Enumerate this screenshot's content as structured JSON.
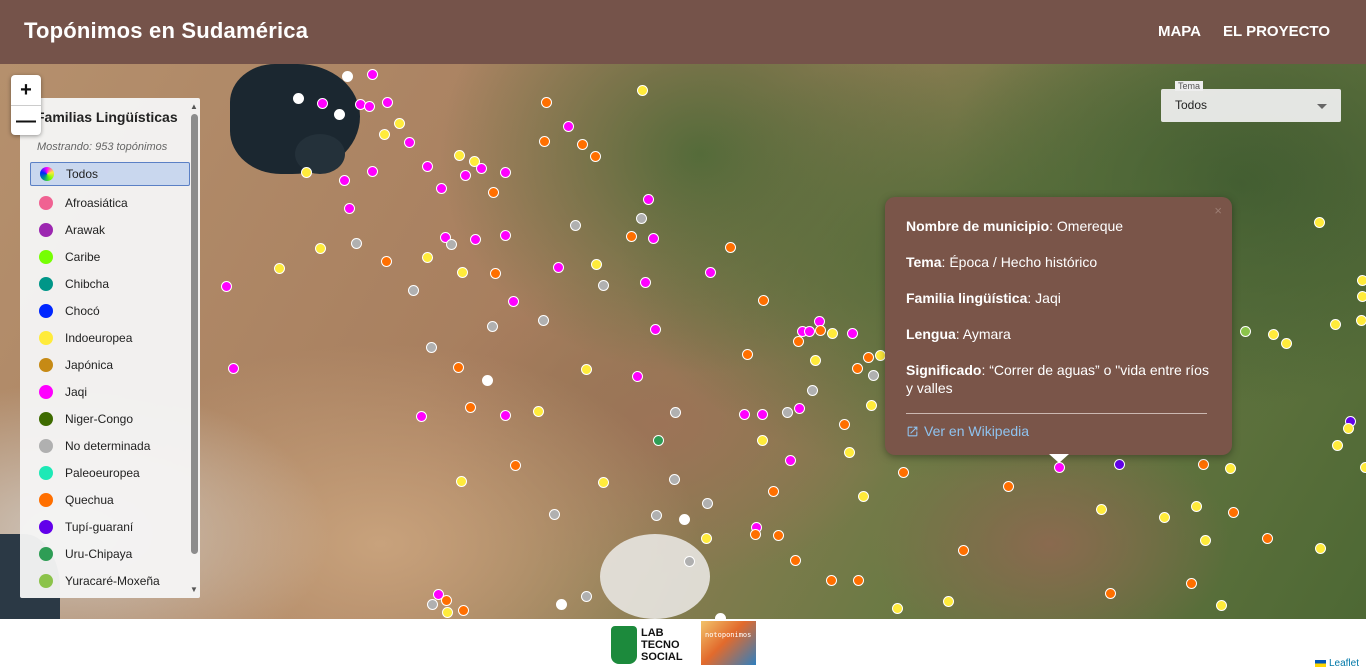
{
  "header": {
    "title": "Topónimos en Sudamérica",
    "nav": [
      "MAPA",
      "EL PROYECTO"
    ]
  },
  "map": {
    "zoom_in": "+",
    "zoom_out": "—",
    "attribution": "Leaflet",
    "colors": {
      "Afroasiática": "#f06292",
      "Arawak": "#9c27b0",
      "Caribe": "#76ff03",
      "Chibcha": "#009688",
      "Chocó": "#0026ff",
      "Indoeuropea": "#ffeb3b",
      "Japónica": "#c68a15",
      "Jaqi": "#ff00ff",
      "Niger-Congo": "#3e6b00",
      "No determinada": "#b0b0b0",
      "Paleoeuropea": "#1de9b6",
      "Quechua": "#ff6f00",
      "Tupí-guaraní": "#6200ea",
      "Uru-Chipaya": "#2e9d55",
      "Yuracaré-Moxeña": "#8bc34a"
    }
  },
  "legend": {
    "title": "Familias Lingüísticas",
    "count_text": "Mostrando: 953 topónimos",
    "items": [
      {
        "label": "Todos",
        "color": "multi"
      },
      {
        "label": "Afroasiática",
        "color": "#f06292"
      },
      {
        "label": "Arawak",
        "color": "#9c27b0"
      },
      {
        "label": "Caribe",
        "color": "#76ff03"
      },
      {
        "label": "Chibcha",
        "color": "#009688"
      },
      {
        "label": "Chocó",
        "color": "#0026ff"
      },
      {
        "label": "Indoeuropea",
        "color": "#ffeb3b"
      },
      {
        "label": "Japónica",
        "color": "#c68a15"
      },
      {
        "label": "Jaqi",
        "color": "#ff00ff"
      },
      {
        "label": "Niger-Congo",
        "color": "#3e6b00"
      },
      {
        "label": "No determinada",
        "color": "#b0b0b0"
      },
      {
        "label": "Paleoeuropea",
        "color": "#1de9b6"
      },
      {
        "label": "Quechua",
        "color": "#ff6f00"
      },
      {
        "label": "Tupí-guaraní",
        "color": "#6200ea"
      },
      {
        "label": "Uru-Chipaya",
        "color": "#2e9d55"
      },
      {
        "label": "Yuracaré-Moxeña",
        "color": "#8bc34a"
      }
    ]
  },
  "theme_select": {
    "label": "Tema",
    "value": "Todos"
  },
  "popup": {
    "rows": [
      {
        "key": "Nombre de municipio",
        "value": ": Omereque"
      },
      {
        "key": "Tema",
        "value": ": Época / Hecho histórico"
      },
      {
        "key": "Familia lingüística",
        "value": ": Jaqi"
      },
      {
        "key": "Lengua",
        "value": ": Aymara"
      },
      {
        "key": "Significado",
        "value": ": “Correr de aguas” o \"vida entre ríos y valles"
      }
    ],
    "link": "Ver en Wikipedia",
    "close": "×"
  },
  "footer": {
    "lab_logo_text": [
      "LAB",
      "TECNO",
      "SOCIAL"
    ],
    "topo_logo_text": "notoponimos"
  }
}
